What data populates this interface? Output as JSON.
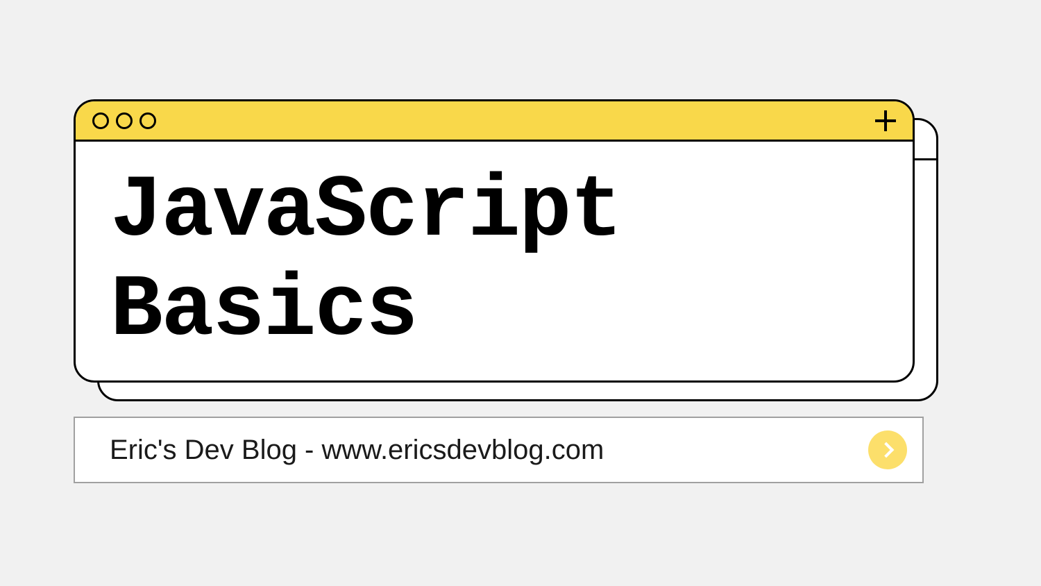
{
  "window": {
    "title": "JavaScript Basics"
  },
  "searchBar": {
    "text": "Eric's Dev Blog - www.ericsdevblog.com"
  },
  "colors": {
    "headerYellow": "#f9d84a",
    "buttonYellow": "#fcdf6b",
    "background": "#f1f1f1"
  }
}
